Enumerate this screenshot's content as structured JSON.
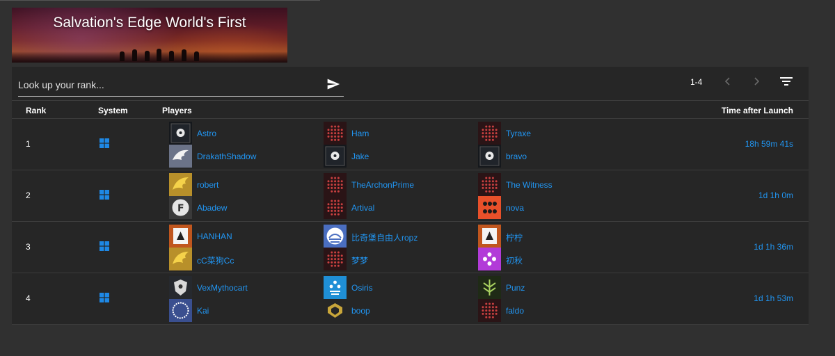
{
  "banner": {
    "title": "Salvation's Edge World's First"
  },
  "search": {
    "placeholder": "Look up your rank..."
  },
  "pagination": {
    "range": "1-4"
  },
  "headers": {
    "rank": "Rank",
    "system": "System",
    "players": "Players",
    "time": "Time after Launch"
  },
  "rows": [
    {
      "rank": "1",
      "system": "windows-icon",
      "time": "18h 59m 41s",
      "players": [
        {
          "name": "Astro",
          "emblem": "dark-ghost"
        },
        {
          "name": "DrakathShadow",
          "emblem": "white-wing"
        },
        {
          "name": "Ham",
          "emblem": "red-dots"
        },
        {
          "name": "Jake",
          "emblem": "dark-ghost"
        },
        {
          "name": "Tyraxe",
          "emblem": "red-dots"
        },
        {
          "name": "bravo",
          "emblem": "dark-ghost"
        }
      ]
    },
    {
      "rank": "2",
      "system": "windows-icon",
      "time": "1d 1h 0m",
      "players": [
        {
          "name": "robert",
          "emblem": "gold-wing"
        },
        {
          "name": "Abadew",
          "emblem": "gray-f"
        },
        {
          "name": "TheArchonPrime",
          "emblem": "red-dots"
        },
        {
          "name": "Artival",
          "emblem": "red-dots"
        },
        {
          "name": "The Witness",
          "emblem": "red-dots"
        },
        {
          "name": "nova",
          "emblem": "orange-dots"
        }
      ]
    },
    {
      "rank": "3",
      "system": "windows-icon",
      "time": "1d 1h 36m",
      "players": [
        {
          "name": "HANHAN",
          "emblem": "orange-triangle"
        },
        {
          "name": "cC菜狗Cc",
          "emblem": "gold-wing"
        },
        {
          "name": "比奇堡自由人ropz",
          "emblem": "blue-sun"
        },
        {
          "name": "梦梦",
          "emblem": "red-dots"
        },
        {
          "name": "柠柠",
          "emblem": "orange-triangle"
        },
        {
          "name": "初秋",
          "emblem": "pink-diamond"
        }
      ]
    },
    {
      "rank": "4",
      "system": "windows-icon",
      "time": "1d 1h 53m",
      "players": [
        {
          "name": "VexMythocart",
          "emblem": "white-shield"
        },
        {
          "name": "Kai",
          "emblem": "blue-ring"
        },
        {
          "name": "Osiris",
          "emblem": "cyan-diamond"
        },
        {
          "name": "boop",
          "emblem": "gold-crest"
        },
        {
          "name": "Punz",
          "emblem": "green-tree"
        },
        {
          "name": "faldo",
          "emblem": "red-dots"
        }
      ]
    }
  ],
  "colors": {
    "background": "#303030",
    "panel": "#262626",
    "link": "#2196f3",
    "windows": "#1e88e5"
  }
}
